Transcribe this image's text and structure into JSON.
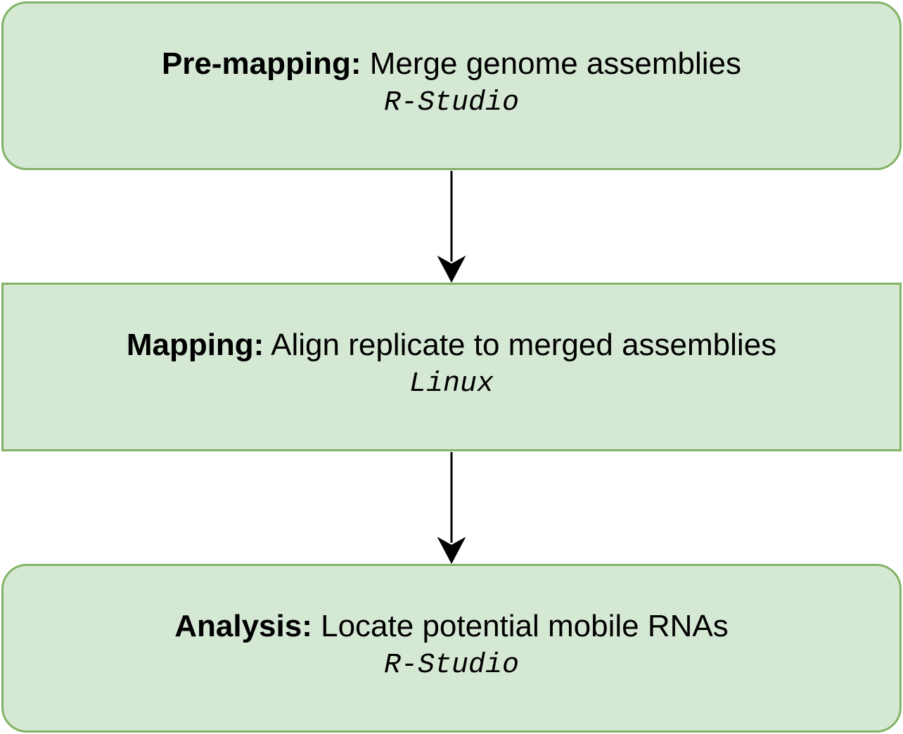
{
  "steps": [
    {
      "stage": "Pre-mapping:",
      "description": "Merge genome assemblies",
      "tool": "R-Studio",
      "shape": "rounded"
    },
    {
      "stage": "Mapping:",
      "description": "Align replicate to merged assemblies",
      "tool": "Linux",
      "shape": "rectangle"
    },
    {
      "stage": "Analysis:",
      "description": "Locate potential mobile RNAs",
      "tool": "R-Studio",
      "shape": "rounded"
    }
  ],
  "colors": {
    "box_fill": "#d5e8d4",
    "box_border": "#82b366",
    "arrow": "#000000",
    "text": "#000000"
  }
}
